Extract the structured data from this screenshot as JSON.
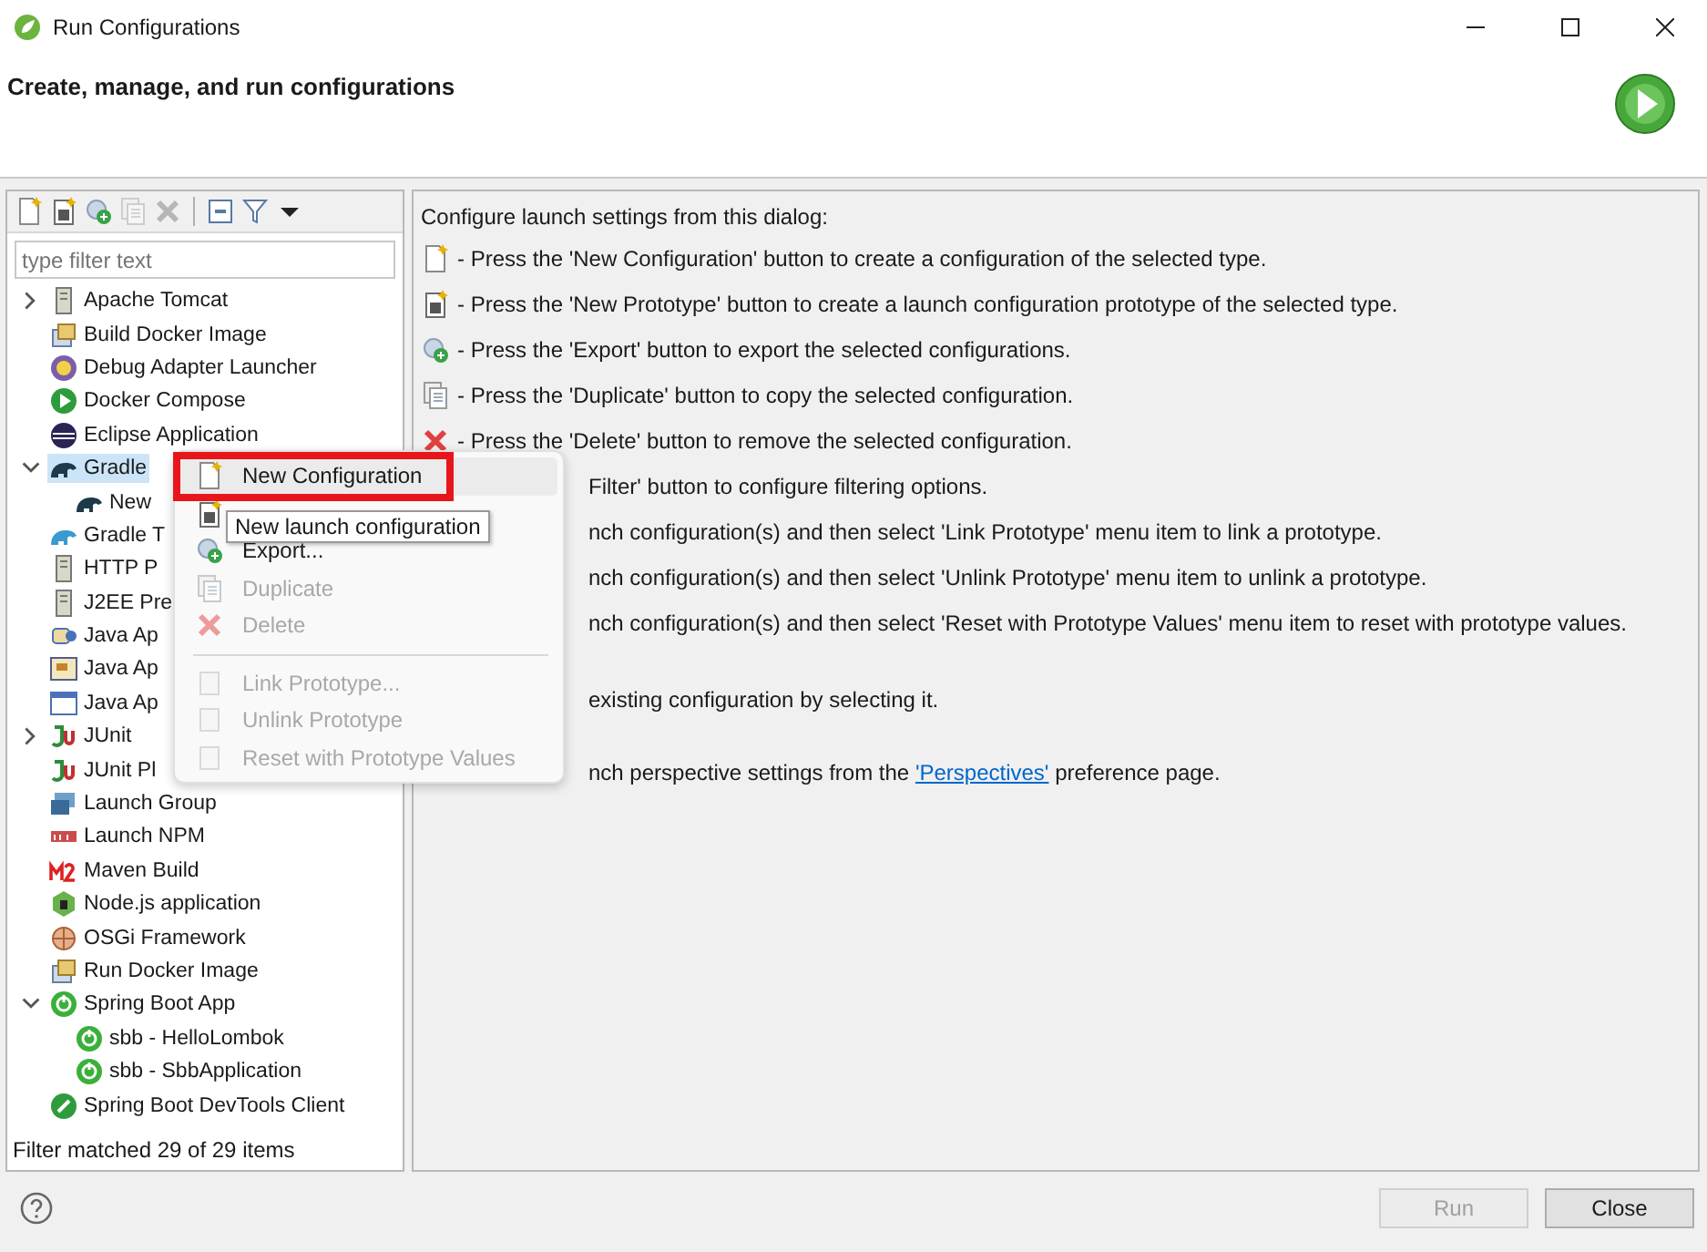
{
  "window": {
    "title": "Run Configurations"
  },
  "header": {
    "title": "Create, manage, and run configurations"
  },
  "toolbar": [
    {
      "kind": "new",
      "disabled": false
    },
    {
      "kind": "prototype",
      "disabled": false
    },
    {
      "kind": "export",
      "disabled": false
    },
    {
      "kind": "duplicate",
      "disabled": true
    },
    {
      "kind": "delete",
      "disabled": true
    },
    {
      "kind": "separator"
    },
    {
      "kind": "collapse",
      "disabled": false
    },
    {
      "kind": "filter",
      "disabled": false
    },
    {
      "kind": "dropdown",
      "disabled": false
    }
  ],
  "filter": {
    "placeholder": "type filter text"
  },
  "tree": [
    {
      "label": "Apache Tomcat",
      "kind": "server",
      "selected": false,
      "expanded": false
    },
    {
      "label": "Build Docker Image",
      "kind": "docker",
      "selected": false
    },
    {
      "label": "Debug Adapter Launcher",
      "kind": "debug",
      "selected": false
    },
    {
      "label": "Docker Compose",
      "kind": "play",
      "selected": false
    },
    {
      "label": "Eclipse Application",
      "kind": "eclipse",
      "selected": false
    },
    {
      "label": "Gradle",
      "kind": "gradle",
      "selected": true,
      "expanded": true,
      "children": [
        {
          "label": "New",
          "kind": "gradle",
          "selected": false
        }
      ]
    },
    {
      "label": "Gradle T",
      "kind": "gradle-task",
      "selected": false
    },
    {
      "label": "HTTP P",
      "kind": "server",
      "selected": false
    },
    {
      "label": "J2EE Pre",
      "kind": "server",
      "selected": false
    },
    {
      "label": "Java Ap",
      "kind": "java",
      "selected": false
    },
    {
      "label": "Java Ap",
      "kind": "applet",
      "selected": false
    },
    {
      "label": "Java Ap",
      "kind": "window",
      "selected": false
    },
    {
      "label": "JUnit",
      "kind": "junit",
      "selected": false,
      "expanded": false
    },
    {
      "label": "JUnit Pl",
      "kind": "junit",
      "selected": false
    },
    {
      "label": "Launch Group",
      "kind": "group",
      "selected": false
    },
    {
      "label": "Launch NPM",
      "kind": "npm",
      "selected": false
    },
    {
      "label": "Maven Build",
      "kind": "maven",
      "selected": false
    },
    {
      "label": "Node.js application",
      "kind": "node",
      "selected": false
    },
    {
      "label": "OSGi Framework",
      "kind": "osgi",
      "selected": false
    },
    {
      "label": "Run Docker Image",
      "kind": "docker",
      "selected": false
    },
    {
      "label": "Spring Boot App",
      "kind": "spring",
      "selected": false,
      "expanded": true,
      "children": [
        {
          "label": "sbb - HelloLombok",
          "kind": "spring",
          "selected": false
        },
        {
          "label": "sbb - SbbApplication",
          "kind": "spring",
          "selected": false
        }
      ]
    },
    {
      "label": "Spring Boot DevTools Client",
      "kind": "devtools",
      "selected": false
    }
  ],
  "filter_status": "Filter matched 29 of 29 items",
  "help_lines": [
    {
      "kind": "heading",
      "text": "Configure launch settings from this dialog:"
    },
    {
      "kind": "new",
      "text": "- Press the 'New Configuration' button to create a configuration of the selected type."
    },
    {
      "kind": "prototype",
      "text": "- Press the 'New Prototype' button to create a launch configuration prototype of the selected type."
    },
    {
      "kind": "export",
      "text": "- Press the 'Export' button to export the selected configurations."
    },
    {
      "kind": "duplicate",
      "text": "- Press the 'Duplicate' button to copy the selected configuration."
    },
    {
      "kind": "delete",
      "text": "- Press the 'Delete' button to remove the selected configuration."
    },
    {
      "kind": "covered",
      "text": "Filter' button to configure filtering options."
    },
    {
      "kind": "covered",
      "text": "nch configuration(s) and then select 'Link Prototype' menu item to link a prototype."
    },
    {
      "kind": "covered",
      "text": "nch configuration(s) and then select 'Unlink Prototype' menu item to unlink a prototype."
    },
    {
      "kind": "covered",
      "text": "nch configuration(s) and then select 'Reset with Prototype Values' menu item to reset with prototype values."
    },
    {
      "kind": "covered-para",
      "text": "existing configuration by selecting it."
    },
    {
      "kind": "link-para",
      "text": "nch perspective settings from the",
      "link": "'Perspectives'",
      "after": "preference page."
    }
  ],
  "context_menu": [
    {
      "kind": "new",
      "label": "New Configuration",
      "disabled": false,
      "selected": true
    },
    {
      "kind": "prototype",
      "disabled": false,
      "selected": false
    },
    {
      "kind": "export",
      "label": "Export...",
      "disabled": false,
      "selected": false
    },
    {
      "kind": "duplicate",
      "label": "Duplicate",
      "disabled": true,
      "selected": false
    },
    {
      "kind": "delete",
      "label": "Delete",
      "disabled": true,
      "selected": false
    },
    {
      "kind": "separator"
    },
    {
      "kind": "link",
      "label": "Link Prototype...",
      "disabled": true,
      "selected": false
    },
    {
      "kind": "unlink",
      "label": "Unlink Prototype",
      "disabled": true,
      "selected": false
    },
    {
      "kind": "reset",
      "label": "Reset with Prototype Values",
      "disabled": true,
      "selected": false
    }
  ],
  "tooltip": "New launch configuration",
  "buttons": [
    {
      "label": "Run",
      "disabled": true
    },
    {
      "label": "Close",
      "disabled": false
    }
  ]
}
